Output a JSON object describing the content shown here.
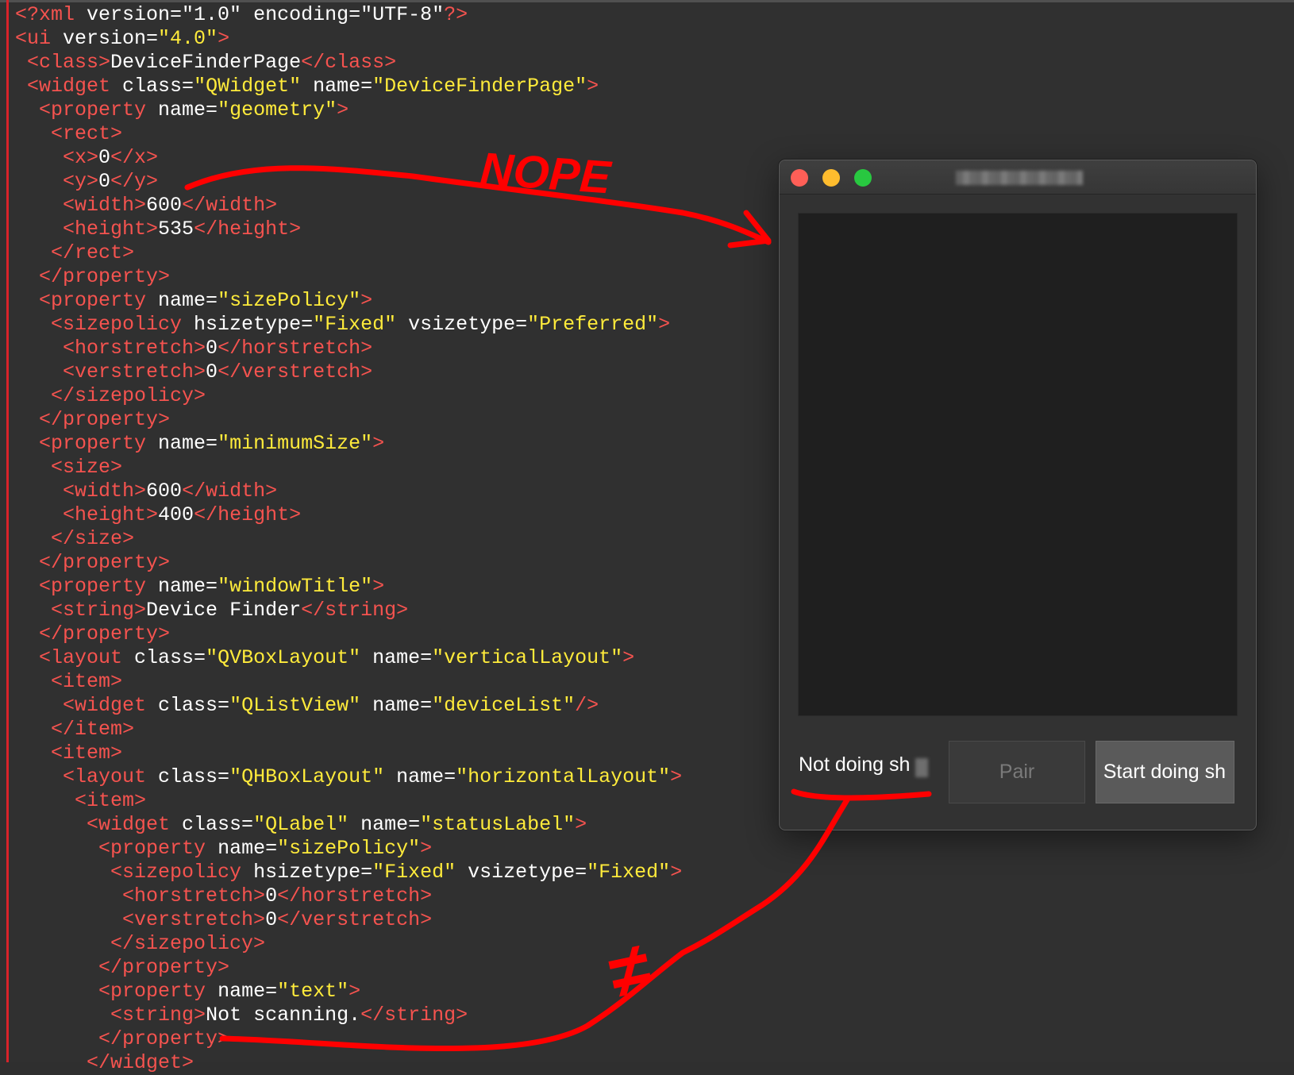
{
  "code_lines": [
    [
      {
        "c": "tag",
        "t": "<?xml "
      },
      {
        "c": "text",
        "t": "version="
      },
      {
        "c": "text",
        "t": "\"1.0\" "
      },
      {
        "c": "text",
        "t": "encoding="
      },
      {
        "c": "text",
        "t": "\"UTF-8\""
      },
      {
        "c": "tag",
        "t": "?>"
      }
    ],
    [
      {
        "c": "tag",
        "t": "<ui "
      },
      {
        "c": "text",
        "t": "version="
      },
      {
        "c": "str",
        "t": "\"4.0\""
      },
      {
        "c": "tag",
        "t": ">"
      }
    ],
    [
      {
        "c": "text",
        "t": " "
      },
      {
        "c": "tag",
        "t": "<class>"
      },
      {
        "c": "text",
        "t": "DeviceFinderPage"
      },
      {
        "c": "tag",
        "t": "</class>"
      }
    ],
    [
      {
        "c": "text",
        "t": " "
      },
      {
        "c": "tag",
        "t": "<widget "
      },
      {
        "c": "text",
        "t": "class="
      },
      {
        "c": "str",
        "t": "\"QWidget\""
      },
      {
        "c": "text",
        "t": " name="
      },
      {
        "c": "str",
        "t": "\"DeviceFinderPage\""
      },
      {
        "c": "tag",
        "t": ">"
      }
    ],
    [
      {
        "c": "text",
        "t": "  "
      },
      {
        "c": "tag",
        "t": "<property "
      },
      {
        "c": "text",
        "t": "name="
      },
      {
        "c": "str",
        "t": "\"geometry\""
      },
      {
        "c": "tag",
        "t": ">"
      }
    ],
    [
      {
        "c": "text",
        "t": "   "
      },
      {
        "c": "tag",
        "t": "<rect>"
      }
    ],
    [
      {
        "c": "text",
        "t": "    "
      },
      {
        "c": "tag",
        "t": "<x>"
      },
      {
        "c": "text",
        "t": "0"
      },
      {
        "c": "tag",
        "t": "</x>"
      }
    ],
    [
      {
        "c": "text",
        "t": "    "
      },
      {
        "c": "tag",
        "t": "<y>"
      },
      {
        "c": "text",
        "t": "0"
      },
      {
        "c": "tag",
        "t": "</y>"
      }
    ],
    [
      {
        "c": "text",
        "t": "    "
      },
      {
        "c": "tag",
        "t": "<width>"
      },
      {
        "c": "text",
        "t": "600"
      },
      {
        "c": "tag",
        "t": "</width>"
      }
    ],
    [
      {
        "c": "text",
        "t": "    "
      },
      {
        "c": "tag",
        "t": "<height>"
      },
      {
        "c": "text",
        "t": "535"
      },
      {
        "c": "tag",
        "t": "</height>"
      }
    ],
    [
      {
        "c": "text",
        "t": "   "
      },
      {
        "c": "tag",
        "t": "</rect>"
      }
    ],
    [
      {
        "c": "text",
        "t": "  "
      },
      {
        "c": "tag",
        "t": "</property>"
      }
    ],
    [
      {
        "c": "text",
        "t": "  "
      },
      {
        "c": "tag",
        "t": "<property "
      },
      {
        "c": "text",
        "t": "name="
      },
      {
        "c": "str",
        "t": "\"sizePolicy\""
      },
      {
        "c": "tag",
        "t": ">"
      }
    ],
    [
      {
        "c": "text",
        "t": "   "
      },
      {
        "c": "tag",
        "t": "<sizepolicy "
      },
      {
        "c": "text",
        "t": "hsizetype="
      },
      {
        "c": "str",
        "t": "\"Fixed\""
      },
      {
        "c": "text",
        "t": " vsizetype="
      },
      {
        "c": "str",
        "t": "\"Preferred\""
      },
      {
        "c": "tag",
        "t": ">"
      }
    ],
    [
      {
        "c": "text",
        "t": "    "
      },
      {
        "c": "tag",
        "t": "<horstretch>"
      },
      {
        "c": "text",
        "t": "0"
      },
      {
        "c": "tag",
        "t": "</horstretch>"
      }
    ],
    [
      {
        "c": "text",
        "t": "    "
      },
      {
        "c": "tag",
        "t": "<verstretch>"
      },
      {
        "c": "text",
        "t": "0"
      },
      {
        "c": "tag",
        "t": "</verstretch>"
      }
    ],
    [
      {
        "c": "text",
        "t": "   "
      },
      {
        "c": "tag",
        "t": "</sizepolicy>"
      }
    ],
    [
      {
        "c": "text",
        "t": "  "
      },
      {
        "c": "tag",
        "t": "</property>"
      }
    ],
    [
      {
        "c": "text",
        "t": "  "
      },
      {
        "c": "tag",
        "t": "<property "
      },
      {
        "c": "text",
        "t": "name="
      },
      {
        "c": "str",
        "t": "\"minimumSize\""
      },
      {
        "c": "tag",
        "t": ">"
      }
    ],
    [
      {
        "c": "text",
        "t": "   "
      },
      {
        "c": "tag",
        "t": "<size>"
      }
    ],
    [
      {
        "c": "text",
        "t": "    "
      },
      {
        "c": "tag",
        "t": "<width>"
      },
      {
        "c": "text",
        "t": "600"
      },
      {
        "c": "tag",
        "t": "</width>"
      }
    ],
    [
      {
        "c": "text",
        "t": "    "
      },
      {
        "c": "tag",
        "t": "<height>"
      },
      {
        "c": "text",
        "t": "400"
      },
      {
        "c": "tag",
        "t": "</height>"
      }
    ],
    [
      {
        "c": "text",
        "t": "   "
      },
      {
        "c": "tag",
        "t": "</size>"
      }
    ],
    [
      {
        "c": "text",
        "t": "  "
      },
      {
        "c": "tag",
        "t": "</property>"
      }
    ],
    [
      {
        "c": "text",
        "t": "  "
      },
      {
        "c": "tag",
        "t": "<property "
      },
      {
        "c": "text",
        "t": "name="
      },
      {
        "c": "str",
        "t": "\"windowTitle\""
      },
      {
        "c": "tag",
        "t": ">"
      }
    ],
    [
      {
        "c": "text",
        "t": "   "
      },
      {
        "c": "tag",
        "t": "<string>"
      },
      {
        "c": "text",
        "t": "Device Finder"
      },
      {
        "c": "tag",
        "t": "</string>"
      }
    ],
    [
      {
        "c": "text",
        "t": "  "
      },
      {
        "c": "tag",
        "t": "</property>"
      }
    ],
    [
      {
        "c": "text",
        "t": "  "
      },
      {
        "c": "tag",
        "t": "<layout "
      },
      {
        "c": "text",
        "t": "class="
      },
      {
        "c": "str",
        "t": "\"QVBoxLayout\""
      },
      {
        "c": "text",
        "t": " name="
      },
      {
        "c": "str",
        "t": "\"verticalLayout\""
      },
      {
        "c": "tag",
        "t": ">"
      }
    ],
    [
      {
        "c": "text",
        "t": "   "
      },
      {
        "c": "tag",
        "t": "<item>"
      }
    ],
    [
      {
        "c": "text",
        "t": "    "
      },
      {
        "c": "tag",
        "t": "<widget "
      },
      {
        "c": "text",
        "t": "class="
      },
      {
        "c": "str",
        "t": "\"QListView\""
      },
      {
        "c": "text",
        "t": " name="
      },
      {
        "c": "str",
        "t": "\"deviceList\""
      },
      {
        "c": "tag",
        "t": "/>"
      }
    ],
    [
      {
        "c": "text",
        "t": "   "
      },
      {
        "c": "tag",
        "t": "</item>"
      }
    ],
    [
      {
        "c": "text",
        "t": "   "
      },
      {
        "c": "tag",
        "t": "<item>"
      }
    ],
    [
      {
        "c": "text",
        "t": "    "
      },
      {
        "c": "tag",
        "t": "<layout "
      },
      {
        "c": "text",
        "t": "class="
      },
      {
        "c": "str",
        "t": "\"QHBoxLayout\""
      },
      {
        "c": "text",
        "t": " name="
      },
      {
        "c": "str",
        "t": "\"horizontalLayout\""
      },
      {
        "c": "tag",
        "t": ">"
      }
    ],
    [
      {
        "c": "text",
        "t": "     "
      },
      {
        "c": "tag",
        "t": "<item>"
      }
    ],
    [
      {
        "c": "text",
        "t": "      "
      },
      {
        "c": "tag",
        "t": "<widget "
      },
      {
        "c": "text",
        "t": "class="
      },
      {
        "c": "str",
        "t": "\"QLabel\""
      },
      {
        "c": "text",
        "t": " name="
      },
      {
        "c": "str",
        "t": "\"statusLabel\""
      },
      {
        "c": "tag",
        "t": ">"
      }
    ],
    [
      {
        "c": "text",
        "t": "       "
      },
      {
        "c": "tag",
        "t": "<property "
      },
      {
        "c": "text",
        "t": "name="
      },
      {
        "c": "str",
        "t": "\"sizePolicy\""
      },
      {
        "c": "tag",
        "t": ">"
      }
    ],
    [
      {
        "c": "text",
        "t": "        "
      },
      {
        "c": "tag",
        "t": "<sizepolicy "
      },
      {
        "c": "text",
        "t": "hsizetype="
      },
      {
        "c": "str",
        "t": "\"Fixed\""
      },
      {
        "c": "text",
        "t": " vsizetype="
      },
      {
        "c": "str",
        "t": "\"Fixed\""
      },
      {
        "c": "tag",
        "t": ">"
      }
    ],
    [
      {
        "c": "text",
        "t": "         "
      },
      {
        "c": "tag",
        "t": "<horstretch>"
      },
      {
        "c": "text",
        "t": "0"
      },
      {
        "c": "tag",
        "t": "</horstretch>"
      }
    ],
    [
      {
        "c": "text",
        "t": "         "
      },
      {
        "c": "tag",
        "t": "<verstretch>"
      },
      {
        "c": "text",
        "t": "0"
      },
      {
        "c": "tag",
        "t": "</verstretch>"
      }
    ],
    [
      {
        "c": "text",
        "t": "        "
      },
      {
        "c": "tag",
        "t": "</sizepolicy>"
      }
    ],
    [
      {
        "c": "text",
        "t": "       "
      },
      {
        "c": "tag",
        "t": "</property>"
      }
    ],
    [
      {
        "c": "text",
        "t": "       "
      },
      {
        "c": "tag",
        "t": "<property "
      },
      {
        "c": "text",
        "t": "name="
      },
      {
        "c": "str",
        "t": "\"text\""
      },
      {
        "c": "tag",
        "t": ">"
      }
    ],
    [
      {
        "c": "text",
        "t": "        "
      },
      {
        "c": "tag",
        "t": "<string>"
      },
      {
        "c": "text",
        "t": "Not scanning."
      },
      {
        "c": "tag",
        "t": "</string>"
      }
    ],
    [
      {
        "c": "text",
        "t": "       "
      },
      {
        "c": "tag",
        "t": "</property>"
      }
    ],
    [
      {
        "c": "text",
        "t": "      "
      },
      {
        "c": "tag",
        "t": "</widget>"
      }
    ]
  ],
  "app_window": {
    "status_label": "Not doing sh",
    "pair_button": "Pair",
    "start_button": "Start doing sh"
  },
  "annotations": {
    "nope_text": "NOPE",
    "not_equal_symbol": "≠"
  },
  "colors": {
    "editor_background": "#303030",
    "tag": "#f5534f",
    "text": "#ffffff",
    "string": "#ffeb3b",
    "annotation": "#ff0000"
  }
}
